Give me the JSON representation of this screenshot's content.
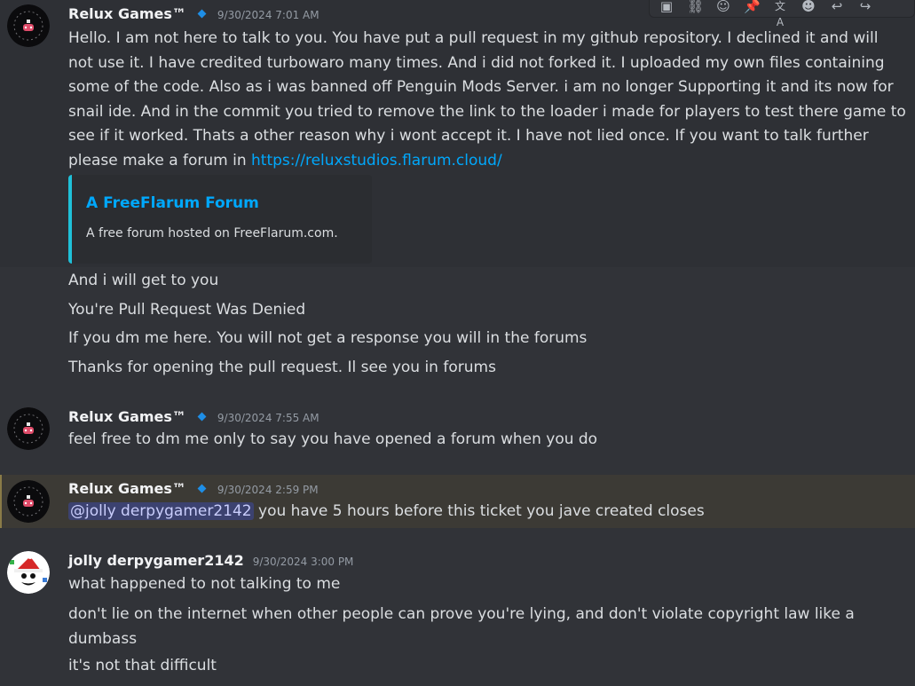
{
  "toolbar": {
    "icons": [
      "app-icon",
      "link-icon",
      "reaction-icon",
      "pin-icon",
      "translate-icon",
      "emoji-icon",
      "reply-icon",
      "forward-icon"
    ],
    "glyphs": [
      "▣",
      "⛓",
      "☺",
      "📌",
      "文A",
      "☻",
      "↩",
      "↪"
    ]
  },
  "messages": [
    {
      "author": "Relux Games™",
      "timestamp": "9/30/2024 7:01 AM",
      "body": "Hello. I am not here to talk to you. You have put a pull request in my github repository. I declined it and will not use it. I have credited turbowaro many times. And i did not forked it. I uploaded my own files containing some of the code. Also as i was banned off Penguin Mods Server. i am no longer Supporting it and its now for snail ide. And in the commit you tried to remove the link to the loader i made for players to test there game to see if it worked. Thats a other reason why i wont accept it. I have not lied once. If you want to talk further please make a forum in ",
      "link": "https://reluxstudios.flarum.cloud/",
      "embed": {
        "title": "A FreeFlarum Forum",
        "description": "A free forum hosted on FreeFlarum.com."
      }
    },
    {
      "body": "And i will get to you"
    },
    {
      "body": "You're Pull Request Was Denied"
    },
    {
      "body": "If you dm me here. You will not get a response you will in the forums"
    },
    {
      "body": "Thanks for opening the pull request. Il see you in forums"
    },
    {
      "author": "Relux Games™",
      "timestamp": "9/30/2024 7:55 AM",
      "body": "feel free to dm me only to say you have opened a forum when you do"
    },
    {
      "author": "Relux Games™",
      "timestamp": "9/30/2024 2:59 PM",
      "mention": "@jolly derpygamer2142",
      "body": " you have 5 hours before this ticket you jave created closes"
    },
    {
      "author": "jolly derpygamer2142",
      "timestamp": "9/30/2024 3:00 PM",
      "body": "what happened to not talking to me"
    },
    {
      "body": "don't lie on the internet when other people can prove you're lying, and don't violate copyright law like a dumbass"
    },
    {
      "body": "it's not that difficult"
    }
  ],
  "colors": {
    "background": "#313338",
    "link": "#00a8fc",
    "mention_highlight": "#3c3a35",
    "embed_border": "#1fc0d8"
  }
}
